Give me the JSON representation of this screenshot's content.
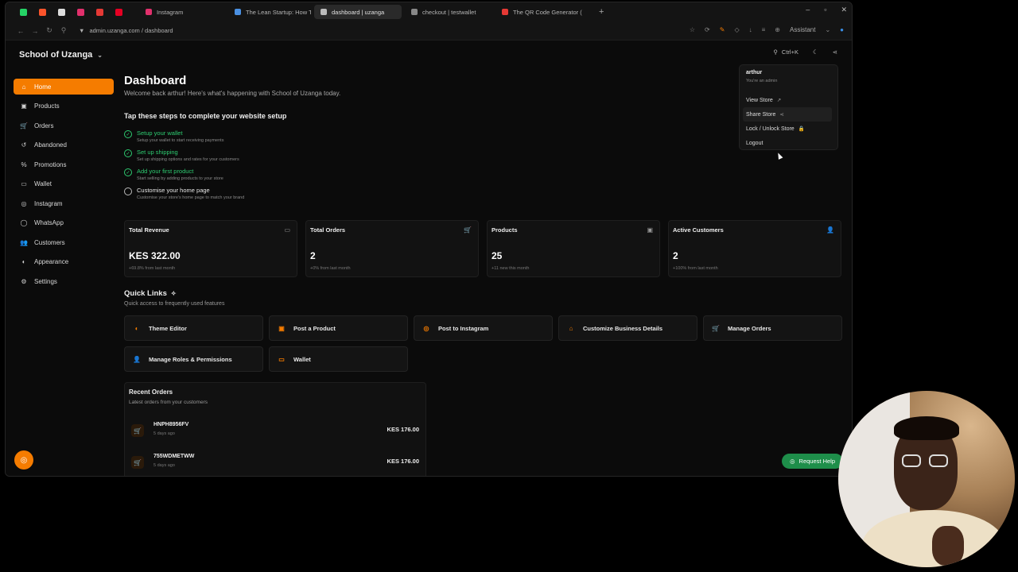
{
  "browser": {
    "pinned_tabs": [
      {
        "icon": "whatsapp-icon",
        "color": "#25d366"
      },
      {
        "icon": "brave-icon",
        "color": "#fb542b"
      },
      {
        "icon": "chatgpt-icon",
        "color": "#dddddd"
      },
      {
        "icon": "instagram-icon",
        "color": "#e1306c"
      },
      {
        "icon": "app-icon",
        "color": "#e53935"
      },
      {
        "icon": "pinterest-icon",
        "color": "#e60023"
      }
    ],
    "tabs": [
      {
        "label": "Instagram",
        "icon_color": "#e1306c",
        "active": false
      },
      {
        "label": "The Lean Startup: How To",
        "icon_color": "#4a90e2",
        "active": false
      },
      {
        "label": "dashboard | uzanga",
        "icon_color": "#bbbbbb",
        "active": true
      },
      {
        "label": "checkout | testwallet",
        "icon_color": "#888888",
        "active": false
      },
      {
        "label": "The QR Code Generator (",
        "icon_color": "#e53935",
        "active": false
      }
    ],
    "new_tab": "+",
    "url": "admin.uzanga.com / dashboard",
    "assistant": "Assistant"
  },
  "app": {
    "store_name": "School of Uzanga",
    "search_shortcut": "Ctrl+K",
    "accent": "#f57c00",
    "sidebar": [
      {
        "label": "Home",
        "icon": "home-icon",
        "glyph": "⌂",
        "active": true
      },
      {
        "label": "Products",
        "icon": "box-icon",
        "glyph": "▣",
        "active": false
      },
      {
        "label": "Orders",
        "icon": "cart-icon",
        "glyph": "🛒",
        "active": false
      },
      {
        "label": "Abandoned",
        "icon": "abandoned-icon",
        "glyph": "↺",
        "active": false
      },
      {
        "label": "Promotions",
        "icon": "percent-icon",
        "glyph": "%",
        "active": false
      },
      {
        "label": "Wallet",
        "icon": "wallet-icon",
        "glyph": "▭",
        "active": false
      },
      {
        "label": "Instagram",
        "icon": "instagram-icon",
        "glyph": "◎",
        "active": false
      },
      {
        "label": "WhatsApp",
        "icon": "whatsapp-icon",
        "glyph": "◯",
        "active": false
      },
      {
        "label": "Customers",
        "icon": "users-icon",
        "glyph": "👥",
        "active": false
      },
      {
        "label": "Appearance",
        "icon": "palette-icon",
        "glyph": "◐",
        "active": false
      },
      {
        "label": "Settings",
        "icon": "gear-icon",
        "glyph": "⚙",
        "active": false
      }
    ],
    "page_title": "Dashboard",
    "welcome": "Welcome back arthur! Here's what's happening with School of Uzanga today.",
    "setup_title": "Tap these steps to complete your website setup",
    "steps": [
      {
        "title": "Setup your wallet",
        "desc": "Setup your wallet to start receiving payments",
        "done": true
      },
      {
        "title": "Set up shipping",
        "desc": "Set up shipping options and rates for your customers",
        "done": true
      },
      {
        "title": "Add your first product",
        "desc": "Start selling by adding products to your store",
        "done": true
      },
      {
        "title": "Customise your home page",
        "desc": "Customise your store's home page to match your brand",
        "done": false
      }
    ],
    "stats": [
      {
        "label": "Total Revenue",
        "value": "KES 322.00",
        "sub": "+69.8% from last month",
        "icon": "credit-card-icon",
        "glyph": "▭"
      },
      {
        "label": "Total Orders",
        "value": "2",
        "sub": "+0% from last month",
        "icon": "cart-icon",
        "glyph": "🛒"
      },
      {
        "label": "Products",
        "value": "25",
        "sub": "+11 new this month",
        "icon": "box-icon",
        "glyph": "▣"
      },
      {
        "label": "Active Customers",
        "value": "2",
        "sub": "+100% from last month",
        "icon": "users-icon",
        "glyph": "👤"
      }
    ],
    "quick_links_title": "Quick Links",
    "quick_links_sub": "Quick access to frequently used features",
    "quick_links": [
      {
        "label": "Theme Editor",
        "icon": "palette-icon",
        "glyph": "◐"
      },
      {
        "label": "Post a Product",
        "icon": "box-icon",
        "glyph": "▣"
      },
      {
        "label": "Post to Instagram",
        "icon": "instagram-icon",
        "glyph": "◎"
      },
      {
        "label": "Customize Business Details",
        "icon": "store-icon",
        "glyph": "⌂"
      },
      {
        "label": "Manage Orders",
        "icon": "cart-icon",
        "glyph": "🛒"
      },
      {
        "label": "Manage Roles & Permissions",
        "icon": "user-gear-icon",
        "glyph": "👤"
      },
      {
        "label": "Wallet",
        "icon": "wallet-icon",
        "glyph": "▭"
      }
    ],
    "recent_title": "Recent Orders",
    "recent_sub": "Latest orders from your customers",
    "orders": [
      {
        "id": "HNPH8956FV",
        "time": "5 days ago",
        "amount": "KES 176.00"
      },
      {
        "id": "755WDMETWW",
        "time": "5 days ago",
        "amount": "KES 176.00"
      }
    ],
    "menu": {
      "user": "arthur",
      "role": "You're an admin",
      "items": [
        {
          "label": "View Store",
          "icon": "external-link-icon",
          "glyph": "↗"
        },
        {
          "label": "Share Store",
          "icon": "share-icon",
          "glyph": "⋖"
        },
        {
          "label": "Lock / Unlock Store",
          "icon": "lock-icon",
          "glyph": "🔒"
        },
        {
          "label": "Logout",
          "icon": "",
          "glyph": ""
        }
      ]
    },
    "request_help": "Request Help"
  }
}
